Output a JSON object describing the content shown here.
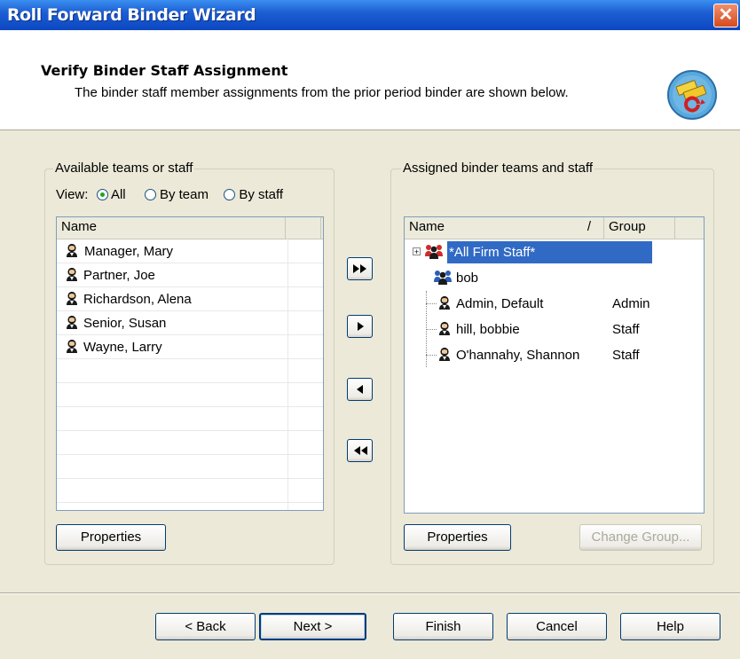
{
  "window": {
    "title": "Roll Forward Binder Wizard",
    "close_glyph": "✕"
  },
  "header": {
    "title": "Verify Binder Staff Assignment",
    "subtitle": "The binder staff member assignments from the prior period binder are shown below.",
    "icon": "binder-rollforward-icon"
  },
  "available": {
    "group_label": "Available teams or staff",
    "view_label": "View:",
    "view_options": [
      {
        "label": "All",
        "selected": true
      },
      {
        "label": "By team",
        "selected": false
      },
      {
        "label": "By staff",
        "selected": false
      }
    ],
    "column_name": "Name",
    "items": [
      "Manager, Mary",
      "Partner, Joe",
      "Richardson, Alena",
      "Senior, Susan",
      "Wayne, Larry"
    ],
    "properties_label": "Properties"
  },
  "move_buttons": [
    {
      "glyph": "add-all",
      "icon": "double-right-arrow-icon"
    },
    {
      "glyph": "add",
      "icon": "right-arrow-icon"
    },
    {
      "glyph": "remove",
      "icon": "left-arrow-icon"
    },
    {
      "glyph": "remove-all",
      "icon": "double-left-arrow-icon"
    }
  ],
  "assigned": {
    "group_label": "Assigned binder teams and staff",
    "column_name": "Name",
    "sort_indicator": "/",
    "column_group": "Group",
    "items": [
      {
        "name": "*All Firm Staff*",
        "group": "",
        "type": "team",
        "selected": true,
        "expander": "+"
      },
      {
        "name": "bob",
        "group": "",
        "type": "team",
        "selected": false
      },
      {
        "name": "Admin, Default",
        "group": "Admin",
        "type": "person",
        "selected": false
      },
      {
        "name": "hill, bobbie",
        "group": "Staff",
        "type": "person",
        "selected": false
      },
      {
        "name": "O'hannahy, Shannon",
        "group": "Staff",
        "type": "person",
        "selected": false
      }
    ],
    "properties_label": "Properties",
    "change_group_label": "Change Group..."
  },
  "footer": {
    "back_label": "< Back",
    "next_label": "Next >",
    "finish_label": "Finish",
    "cancel_label": "Cancel",
    "help_label": "Help"
  },
  "colors": {
    "selection": "#316ac5",
    "titlebar": "#0b47c2",
    "face": "#ece9d8"
  }
}
